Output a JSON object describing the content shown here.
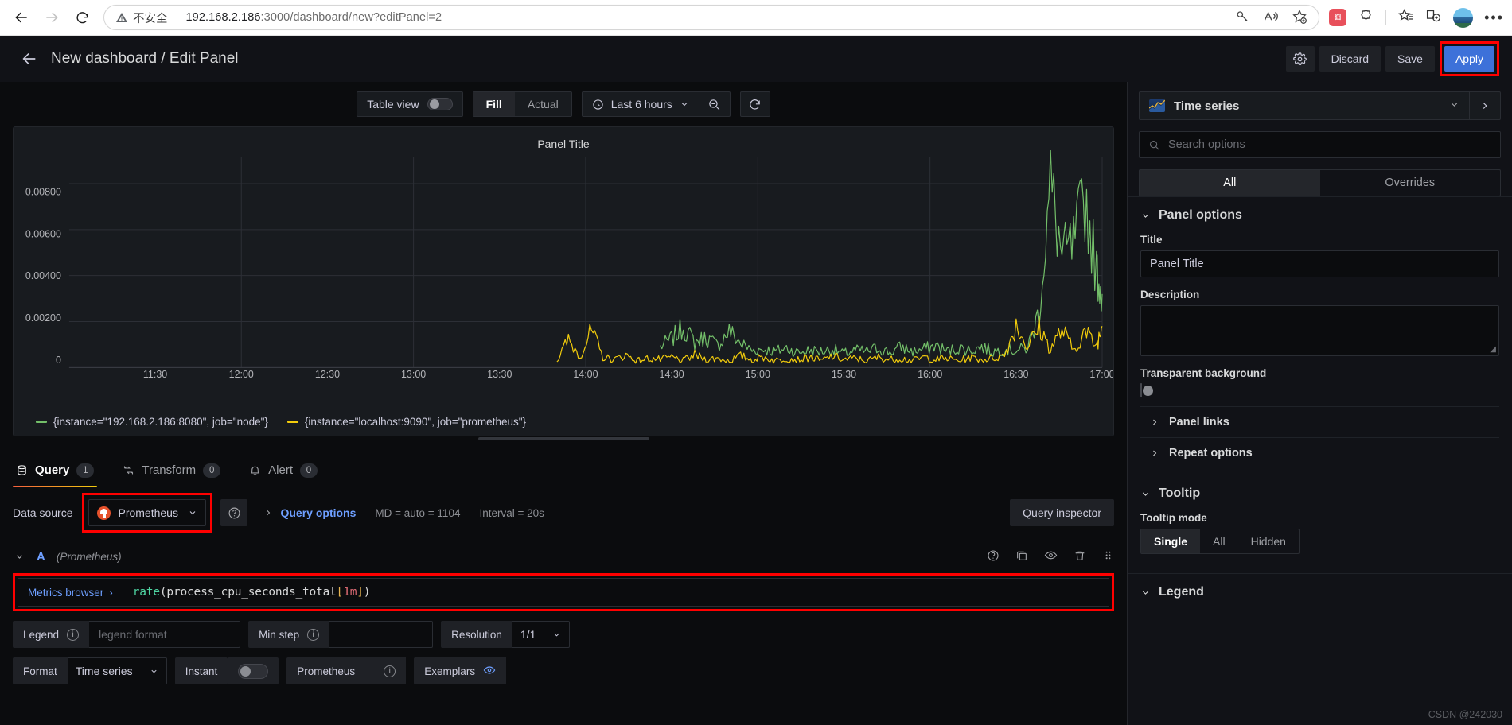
{
  "browser": {
    "security_warning": "不安全",
    "url_host": "192.168.2.186",
    "url_path": ":3000/dashboard/new?editPanel=2",
    "icons": {
      "back": "back-arrow-icon",
      "forward": "forward-arrow-icon",
      "reload": "reload-icon",
      "warning": "warning-triangle-icon",
      "key": "key-icon",
      "read_aloud": "read-aloud-icon",
      "favorite": "add-favorite-icon",
      "extension": "extension-icon",
      "puzzle": "collections-icon",
      "favorites_bar": "favorites-icon",
      "split": "split-screen-icon",
      "profile": "profile-avatar",
      "more": "more-settings-icon"
    }
  },
  "header": {
    "title": "New dashboard / Edit Panel",
    "back_icon": "back-arrow-icon",
    "settings_icon": "gear-icon",
    "discard_label": "Discard",
    "save_label": "Save",
    "apply_label": "Apply"
  },
  "toolbar": {
    "table_view_label": "Table view",
    "table_view_on": false,
    "fill_label": "Fill",
    "actual_label": "Actual",
    "fill_active": true,
    "time_range": "Last 6 hours",
    "clock_icon": "clock-icon",
    "chevron_icon": "chevron-down-icon",
    "zoom_out_icon": "zoom-out-icon",
    "refresh_icon": "refresh-icon"
  },
  "panel": {
    "title": "Panel Title"
  },
  "chart_data": {
    "type": "line",
    "title": "Panel Title",
    "xlabel": "",
    "ylabel": "",
    "ylim": [
      0,
      0.009
    ],
    "yticks": [
      "0.00800",
      "0.00600",
      "0.00400",
      "0.00200",
      "0"
    ],
    "ytick_values": [
      0.008,
      0.006,
      0.004,
      0.002,
      0
    ],
    "xticks": [
      "11:30",
      "12:00",
      "12:30",
      "13:00",
      "13:30",
      "14:00",
      "14:30",
      "15:00",
      "15:30",
      "16:00",
      "16:30",
      "17:00"
    ],
    "grid": true,
    "legend_position": "bottom",
    "series": [
      {
        "name": "{instance=\"192.168.2.186:8080\", job=\"node\"}",
        "color": "#73bf69",
        "x": [
          "14:26",
          "14:30",
          "14:34",
          "14:38",
          "14:42",
          "14:46",
          "14:50",
          "14:54",
          "14:58",
          "15:02",
          "15:06",
          "15:10",
          "15:14",
          "15:18",
          "15:22",
          "15:26",
          "15:30",
          "15:34",
          "15:38",
          "15:42",
          "15:46",
          "15:50",
          "15:54",
          "15:58",
          "16:02",
          "16:06",
          "16:10",
          "16:14",
          "16:18",
          "16:22",
          "16:26",
          "16:30",
          "16:34",
          "16:38",
          "16:42",
          "16:46",
          "16:50",
          "16:54",
          "16:58",
          "17:00"
        ],
        "values": [
          0.0009,
          0.00125,
          0.00175,
          0.0011,
          0.0013,
          0.00095,
          0.0016,
          0.00105,
          0.00075,
          0.0008,
          0.0007,
          0.00085,
          0.00065,
          0.00075,
          0.0007,
          0.0008,
          0.0006,
          0.00075,
          0.0007,
          0.00085,
          0.00065,
          0.0009,
          0.0007,
          0.0008,
          0.00095,
          0.0007,
          0.00085,
          0.00075,
          0.0009,
          0.0007,
          0.0008,
          0.00075,
          0.00085,
          0.0024,
          0.0079,
          0.0048,
          0.0053,
          0.0074,
          0.0042,
          0.0032
        ]
      },
      {
        "name": "{instance=\"localhost:9090\", job=\"prometheus\"}",
        "color": "#f2cc0c",
        "x": [
          "13:50",
          "13:54",
          "13:58",
          "14:02",
          "14:06",
          "14:10",
          "14:14",
          "14:18",
          "14:22",
          "14:26",
          "14:30",
          "14:34",
          "14:38",
          "14:42",
          "14:46",
          "14:50",
          "14:54",
          "14:58",
          "15:02",
          "15:06",
          "15:10",
          "15:14",
          "15:18",
          "15:22",
          "15:26",
          "15:30",
          "15:34",
          "15:38",
          "15:42",
          "15:46",
          "15:50",
          "15:54",
          "15:58",
          "16:02",
          "16:06",
          "16:10",
          "16:14",
          "16:18",
          "16:22",
          "16:26",
          "16:30",
          "16:34",
          "16:38",
          "16:42",
          "16:46",
          "16:50",
          "16:54",
          "16:58",
          "17:00"
        ],
        "values": [
          0.0003,
          0.0012,
          0.0005,
          0.0016,
          0.00045,
          0.00035,
          0.00055,
          0.0003,
          0.0004,
          0.00035,
          0.00045,
          0.0003,
          0.00055,
          0.00035,
          0.0004,
          0.0003,
          0.0005,
          0.00035,
          0.00045,
          0.0003,
          0.0004,
          0.00035,
          0.00045,
          0.0003,
          0.0005,
          0.00035,
          0.0004,
          0.0003,
          0.00045,
          0.00035,
          0.0004,
          0.0003,
          0.00045,
          0.00035,
          0.0004,
          0.0003,
          0.00045,
          0.00035,
          0.0004,
          0.00055,
          0.00185,
          0.0009,
          0.00175,
          0.0008,
          0.00165,
          0.00075,
          0.00155,
          0.00095,
          0.0018
        ]
      }
    ],
    "legend": [
      {
        "label": "{instance=\"192.168.2.186:8080\", job=\"node\"}",
        "color": "#73bf69"
      },
      {
        "label": "{instance=\"localhost:9090\", job=\"prometheus\"}",
        "color": "#f2cc0c"
      }
    ]
  },
  "tabs": [
    {
      "label": "Query",
      "count": "1",
      "icon": "database-icon",
      "active": true
    },
    {
      "label": "Transform",
      "count": "0",
      "icon": "transform-icon",
      "active": false
    },
    {
      "label": "Alert",
      "count": "0",
      "icon": "bell-icon",
      "active": false
    }
  ],
  "query": {
    "datasource_label": "Data source",
    "datasource_value": "Prometheus",
    "datasource_icon": "prometheus-logo-icon",
    "help_icon": "help-circle-icon",
    "query_options_label": "Query options",
    "query_options_chevron": "chevron-right-icon",
    "md_info": "MD = auto = 1104",
    "interval_info": "Interval = 20s",
    "query_inspector_label": "Query inspector",
    "row": {
      "letter": "A",
      "datasource": "(Prometheus)",
      "collapse_icon": "chevron-down-icon",
      "actions": [
        "help-circle-icon",
        "duplicate-icon",
        "eye-icon",
        "trash-icon",
        "drag-handle-icon"
      ]
    },
    "metrics_browser_label": "Metrics browser",
    "metrics_browser_chevron": "›",
    "expression": {
      "fn": "rate",
      "open": "(",
      "metric": "process_cpu_seconds_total",
      "bracket_open": "[",
      "duration": "1m",
      "bracket_close": "]",
      "close": ")"
    },
    "legend_label": "Legend",
    "legend_placeholder": "legend format",
    "legend_value": "",
    "min_step_label": "Min step",
    "min_step_value": "",
    "resolution_label": "Resolution",
    "resolution_value": "1/1",
    "format_label": "Format",
    "format_value": "Time series",
    "instant_label": "Instant",
    "instant_on": false,
    "exemplar_source_label": "Prometheus",
    "exemplars_label": "Exemplars",
    "exemplars_icon": "eye-icon"
  },
  "options": {
    "viz_type": "Time series",
    "viz_icon": "time-series-icon",
    "viz_chevron": "chevron-down-icon",
    "viz_expand": "chevron-right-icon",
    "search_placeholder": "Search options",
    "search_icon": "search-icon",
    "tab_all": "All",
    "tab_overrides": "Overrides",
    "panel_options_title": "Panel options",
    "title_label": "Title",
    "title_value": "Panel Title",
    "description_label": "Description",
    "description_value": "",
    "transparent_label": "Transparent background",
    "transparent_on": false,
    "panel_links_label": "Panel links",
    "repeat_options_label": "Repeat options",
    "tooltip_title": "Tooltip",
    "tooltip_mode_label": "Tooltip mode",
    "tooltip_modes": [
      "Single",
      "All",
      "Hidden"
    ],
    "tooltip_mode_active": "Single",
    "legend_title": "Legend"
  },
  "watermark": "CSDN @242030",
  "colors": {
    "accent_blue": "#3d71d9",
    "link_blue": "#6e9fff",
    "series_green": "#73bf69",
    "series_yellow": "#f2cc0c",
    "highlight_red": "#ff0000",
    "panel_bg": "#181b1f",
    "app_bg": "#0b0c0e"
  }
}
